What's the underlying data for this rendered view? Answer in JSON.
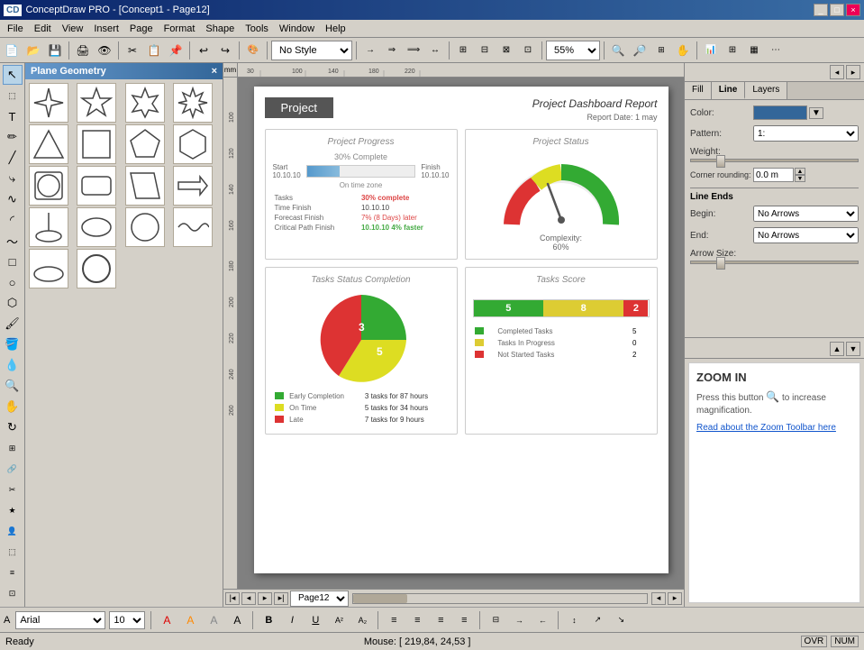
{
  "titlebar": {
    "title": "ConceptDraw PRO - [Concept1 - Page12]",
    "icon": "CD"
  },
  "menubar": {
    "items": [
      "File",
      "Edit",
      "View",
      "Insert",
      "Page",
      "Format",
      "Shape",
      "Tools",
      "Window",
      "Help"
    ]
  },
  "toolbar": {
    "style_dropdown": "No Style",
    "zoom_dropdown": "55%"
  },
  "shape_panel": {
    "title": "Plane Geometry",
    "close_btn": "×",
    "shapes": [
      {
        "name": "4-point star",
        "symbol": "✦"
      },
      {
        "name": "5-point star",
        "symbol": "★"
      },
      {
        "name": "6-point star",
        "symbol": "✶"
      },
      {
        "name": "8-point star",
        "symbol": "✸"
      },
      {
        "name": "triangle",
        "symbol": "△"
      },
      {
        "name": "square",
        "symbol": "□"
      },
      {
        "name": "pentagon",
        "symbol": "⬠"
      },
      {
        "name": "hexagon",
        "symbol": "⬡"
      },
      {
        "name": "circle-square",
        "symbol": "○"
      },
      {
        "name": "rounded-rect",
        "symbol": "▭"
      },
      {
        "name": "parallelogram",
        "symbol": "▱"
      },
      {
        "name": "arrow-shape",
        "symbol": "⬧"
      },
      {
        "name": "ellipse-small",
        "symbol": "◯"
      },
      {
        "name": "oval",
        "symbol": "⬭"
      },
      {
        "name": "circle-large",
        "symbol": "◯"
      },
      {
        "name": "wave-line",
        "symbol": "〜"
      },
      {
        "name": "small-oval",
        "symbol": "⬬"
      },
      {
        "name": "ellipse-vert",
        "symbol": "⬤"
      }
    ]
  },
  "canvas": {
    "page_name": "Page12",
    "zoom": "55%",
    "ruler_marks_h": [
      "mm",
      "30",
      "100",
      "140",
      "180",
      "220"
    ],
    "ruler_marks_v": [
      "100",
      "120",
      "140",
      "160",
      "180",
      "200",
      "220",
      "240",
      "260"
    ]
  },
  "dashboard": {
    "project_label": "Project",
    "report_title": "Project Dashboard Report",
    "report_date_label": "Report Date:",
    "report_date": "1 may",
    "progress": {
      "title": "Project Progress",
      "pct_label": "30% Complete",
      "start_label": "Start",
      "start_date": "10.10.10",
      "finish_label": "Finish",
      "finish_date": "10.10.10",
      "on_time_label": "On time zone",
      "rows": [
        {
          "label": "Tasks",
          "value": "30% complete"
        },
        {
          "label": "Time Finish",
          "value": "10.10.10"
        },
        {
          "label": "Forecast Finish",
          "value": "7% (8) Days later"
        },
        {
          "label": "Critical Path Finish",
          "value": "10.10.10  4% faster"
        }
      ]
    },
    "status": {
      "title": "Project Status",
      "complexity_label": "Complexity:",
      "complexity_value": "60%"
    },
    "tasks_completion": {
      "title": "Tasks Status Completion",
      "legend": [
        {
          "label": "Early Completion",
          "value": "3 tasks for 87 hours",
          "color": "#33aa33"
        },
        {
          "label": "On Time",
          "value": "5 tasks for 34 hours",
          "color": "#cccc44"
        },
        {
          "label": "Late",
          "value": "7 tasks for 9 hours",
          "color": "#cc3333"
        }
      ]
    },
    "tasks_score": {
      "title": "Tasks Score",
      "segments": [
        {
          "label": "5",
          "color": "#33aa33",
          "width": "30%"
        },
        {
          "label": "8",
          "color": "#cccc44",
          "width": "45%"
        },
        {
          "label": "2",
          "color": "#cc3333",
          "width": "15%"
        }
      ],
      "rows": [
        {
          "label": "Completed Tasks",
          "value": "5",
          "color": "#33aa33"
        },
        {
          "label": "Tasks In Progress",
          "value": "0",
          "color": "#cccc44"
        },
        {
          "label": "Not Started Tasks",
          "value": "2",
          "color": "#cc3333"
        }
      ]
    }
  },
  "right_panel": {
    "tabs": [
      {
        "label": "Fill",
        "active": false
      },
      {
        "label": "Line",
        "active": true
      },
      {
        "label": "Layers",
        "active": false
      }
    ],
    "fill": {
      "color_label": "Color:",
      "pattern_label": "Pattern:",
      "pattern_value": "1:",
      "weight_label": "Weight:",
      "corner_label": "Corner rounding:",
      "corner_value": "0.0 m"
    },
    "line": {
      "line_ends_label": "Line Ends",
      "begin_label": "Begin:",
      "begin_value": "No Arrows",
      "end_label": "End:",
      "end_value": "No Arrows",
      "arrow_size_label": "Arrow Size:"
    },
    "color_swatch_hex": "#336699"
  },
  "zoom_panel": {
    "title": "ZOOM IN",
    "body": "Press this button  to increase magnification.",
    "link": "Read about the Zoom Toolbar here"
  },
  "statusbar": {
    "status": "Ready",
    "mouse_label": "Mouse:",
    "mouse_coords": "[ 219,84, 24,53 ]",
    "ovr": "OVR",
    "num": "NUM"
  },
  "font_bar": {
    "font_name": "Arial",
    "font_size": "10",
    "buttons": [
      "A",
      "A",
      "A",
      "A",
      "B",
      "I",
      "U",
      "A²",
      "A₂"
    ]
  }
}
